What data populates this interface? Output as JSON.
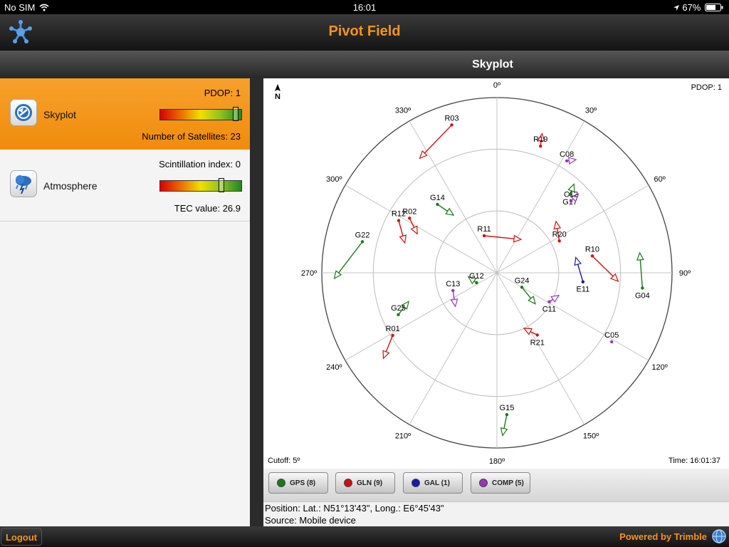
{
  "status_bar": {
    "carrier": "No SIM",
    "time": "16:01",
    "battery": "67%"
  },
  "app": {
    "title": "Pivot Field"
  },
  "header": {
    "page_title": "Skyplot"
  },
  "left_panel": {
    "skyplot_card": {
      "name": "Skyplot",
      "top_label": "PDOP: 1",
      "bottom_label": "Number of Satellites: 23",
      "bar_level": 0.96
    },
    "atmosphere_card": {
      "name": "Atmosphere",
      "top_label": "Scintillation index: 0",
      "bottom_label": "TEC value: 26.9",
      "bar_level": 0.77
    }
  },
  "skyplot": {
    "pdop_label": "PDOP: 1",
    "cutoff_label": "Cutoff: 5º",
    "time_label": "Time: 16:01:37",
    "north_label": "N",
    "elevation_rings": [
      90,
      60,
      30,
      5
    ],
    "azimuth_labels": [
      {
        "az": 0,
        "text": "0º"
      },
      {
        "az": 30,
        "text": "30º"
      },
      {
        "az": 60,
        "text": "60º"
      },
      {
        "az": 90,
        "text": "90º"
      },
      {
        "az": 120,
        "text": "120º"
      },
      {
        "az": 150,
        "text": "150º"
      },
      {
        "az": 180,
        "text": "180º"
      },
      {
        "az": 210,
        "text": "210º"
      },
      {
        "az": 240,
        "text": "240º"
      },
      {
        "az": 270,
        "text": "270º"
      },
      {
        "az": 300,
        "text": "300º"
      },
      {
        "az": 330,
        "text": "330º"
      }
    ],
    "colors": {
      "GPS": "#1a7a1a",
      "GLN": "#cc1111",
      "GAL": "#1a1aaa",
      "COMP": "#9933bb"
    },
    "satellites": [
      {
        "id": "R03",
        "sys": "GLN",
        "az": 343,
        "el": 15,
        "t_az": 326,
        "t_el": 23,
        "label": "above"
      },
      {
        "id": "R19",
        "sys": "GLN",
        "az": 19,
        "el": 25,
        "t_az": 18,
        "t_el": 19,
        "label": "above"
      },
      {
        "id": "C08",
        "sys": "COMP",
        "az": 32,
        "el": 26,
        "t_az": 35,
        "t_el": 23,
        "label": "above"
      },
      {
        "id": "G17",
        "sys": "GPS",
        "az": 43,
        "el": 38,
        "t_az": 41,
        "t_el": 33,
        "label": "below"
      },
      {
        "id": "C12",
        "sys": "COMP",
        "az": 46,
        "el": 40,
        "t_az": 46,
        "t_el": 35,
        "label": "above"
      },
      {
        "id": "G14",
        "sys": "GPS",
        "az": 319,
        "el": 46,
        "t_az": 323,
        "t_el": 55,
        "label": "above"
      },
      {
        "id": "R02",
        "sys": "GLN",
        "az": 302,
        "el": 40,
        "t_az": 296,
        "t_el": 47,
        "label": "above"
      },
      {
        "id": "R12",
        "sys": "GLN",
        "az": 298,
        "el": 36,
        "t_az": 288,
        "t_el": 43,
        "label": "above"
      },
      {
        "id": "R11",
        "sys": "GLN",
        "az": 341,
        "el": 71,
        "t_az": 36,
        "t_el": 70,
        "label": "above"
      },
      {
        "id": "R20",
        "sys": "GLN",
        "az": 63,
        "el": 56,
        "t_az": 49,
        "t_el": 52,
        "label": "above"
      },
      {
        "id": "R10",
        "sys": "GLN",
        "az": 80,
        "el": 43,
        "t_az": 94,
        "t_el": 31,
        "label": "above"
      },
      {
        "id": "G04",
        "sys": "GPS",
        "az": 96,
        "el": 19,
        "t_az": 82,
        "t_el": 20,
        "label": "below"
      },
      {
        "id": "E11",
        "sys": "GAL",
        "az": 96,
        "el": 48,
        "t_az": 79,
        "t_el": 51,
        "label": "below"
      },
      {
        "id": "G22",
        "sys": "GPS",
        "az": 283,
        "el": 23,
        "t_az": 268,
        "t_el": 11,
        "label": "above"
      },
      {
        "id": "C13",
        "sys": "COMP",
        "az": 248,
        "el": 67,
        "t_az": 231,
        "t_el": 64,
        "label": "above"
      },
      {
        "id": "G12",
        "sys": "GPS",
        "az": 244,
        "el": 79,
        "t_az": 262,
        "t_el": 76,
        "label": "above"
      },
      {
        "id": "G24",
        "sys": "GPS",
        "az": 120,
        "el": 76,
        "t_az": 129,
        "t_el": 66,
        "label": "above"
      },
      {
        "id": "C11",
        "sys": "COMP",
        "az": 119,
        "el": 61,
        "t_az": 110,
        "t_el": 58,
        "label": "below"
      },
      {
        "id": "G25",
        "sys": "GPS",
        "az": 247,
        "el": 38,
        "t_az": 252,
        "t_el": 45,
        "label": "above"
      },
      {
        "id": "R01",
        "sys": "GLN",
        "az": 239,
        "el": 31,
        "t_az": 233,
        "t_el": 21,
        "label": "above"
      },
      {
        "id": "C05",
        "sys": "COMP",
        "az": 121,
        "el": 25,
        "t_az": 121,
        "t_el": 25,
        "label": "above"
      },
      {
        "id": "R21",
        "sys": "GLN",
        "az": 147,
        "el": 54,
        "t_az": 154,
        "t_el": 60,
        "label": "below"
      },
      {
        "id": "G15",
        "sys": "GPS",
        "az": 176,
        "el": 21,
        "t_az": 178,
        "t_el": 11,
        "label": "above"
      }
    ]
  },
  "legend": [
    {
      "label": "GPS (8)",
      "color": "#1a7a1a"
    },
    {
      "label": "GLN (9)",
      "color": "#cc1111"
    },
    {
      "label": "GAL (1)",
      "color": "#1a1aaa"
    },
    {
      "label": "COMP (5)",
      "color": "#9933bb"
    }
  ],
  "info": {
    "position": "Position: Lat.: N51°13'43\", Long.: E6°45'43\"",
    "source": "Source: Mobile device"
  },
  "bottom_bar": {
    "logout_label": "Logout",
    "powered_label": "Powered by Trimble"
  },
  "icons": {
    "app_logo": "satellite-network-icon",
    "skyplot": "skyplot-icon",
    "atmosphere": "storm-cloud-icon",
    "north": "north-arrow-icon",
    "trimble": "trimble-globe-icon"
  }
}
